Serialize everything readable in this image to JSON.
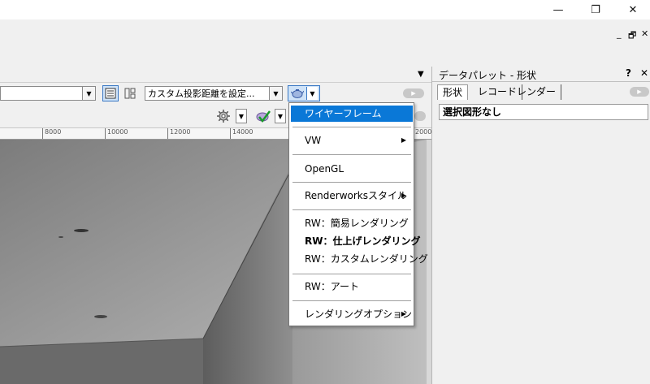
{
  "window": {
    "minimize_glyph": "—",
    "maximize_glyph": "❐",
    "close_glyph": "✕",
    "mdi_minimize": "_",
    "mdi_restore": "🗗",
    "mdi_close": "✕"
  },
  "toolbar": {
    "view_distance_combo": "カスタム投影距離を設定...",
    "dropdown_glyph": "▼",
    "collapse_glyph": "▼"
  },
  "ruler": {
    "labels": [
      "8000",
      "10000",
      "12000",
      "14000",
      "2000"
    ]
  },
  "palette": {
    "title": "データパレット - 形状",
    "help": "?",
    "close": "✕",
    "tabs": [
      "形状",
      "レコード",
      "レンダー"
    ],
    "content": "選択図形なし"
  },
  "render_menu": {
    "items": [
      {
        "label": "ワイヤーフレーム",
        "selected": true
      },
      {
        "label": "VW",
        "submenu": true
      },
      {
        "label": "OpenGL"
      },
      {
        "label": "Renderworksスタイル",
        "submenu": true
      },
      {
        "label": "RW：簡易レンダリング"
      },
      {
        "label": "RW：仕上げレンダリング",
        "bold": true
      },
      {
        "label": "RW：カスタムレンダリング"
      },
      {
        "label": "RW：アート"
      },
      {
        "label": "レンダリングオプション",
        "submenu": true
      }
    ],
    "submenu_glyph": "▶"
  },
  "colors": {
    "menu_highlight": "#0a78d7",
    "pressed_button": "#cfe3f8"
  }
}
